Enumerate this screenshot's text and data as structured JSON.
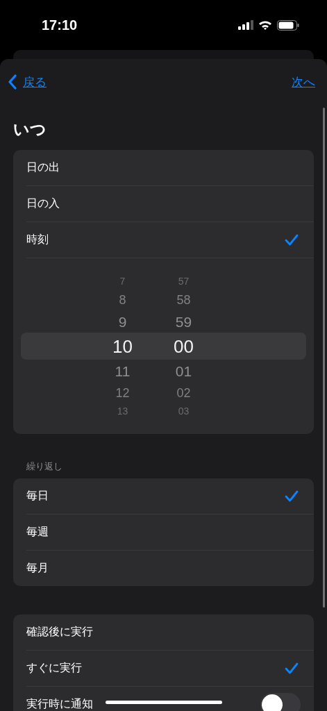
{
  "status_bar": {
    "time": "17:10"
  },
  "nav": {
    "back": "戻る",
    "next": "次へ"
  },
  "title": "いつ",
  "when_options": [
    {
      "label": "日の出",
      "selected": false
    },
    {
      "label": "日の入",
      "selected": false
    },
    {
      "label": "時刻",
      "selected": true
    }
  ],
  "time_picker": {
    "hours": [
      {
        "value": "7",
        "selected": false
      },
      {
        "value": "8",
        "selected": false
      },
      {
        "value": "9",
        "selected": false
      },
      {
        "value": "10",
        "selected": true
      },
      {
        "value": "11",
        "selected": false
      },
      {
        "value": "12",
        "selected": false
      },
      {
        "value": "13",
        "selected": false
      }
    ],
    "minutes": [
      {
        "value": "57",
        "selected": false
      },
      {
        "value": "58",
        "selected": false
      },
      {
        "value": "59",
        "selected": false
      },
      {
        "value": "00",
        "selected": true
      },
      {
        "value": "01",
        "selected": false
      },
      {
        "value": "02",
        "selected": false
      },
      {
        "value": "03",
        "selected": false
      }
    ]
  },
  "repeat": {
    "header": "繰り返し",
    "options": [
      {
        "label": "毎日",
        "selected": true
      },
      {
        "label": "毎週",
        "selected": false
      },
      {
        "label": "毎月",
        "selected": false
      }
    ]
  },
  "run_options": [
    {
      "kind": "check",
      "label": "確認後に実行",
      "selected": false
    },
    {
      "kind": "check",
      "label": "すぐに実行",
      "selected": true
    },
    {
      "kind": "toggle",
      "label": "実行時に通知",
      "on": false
    }
  ]
}
